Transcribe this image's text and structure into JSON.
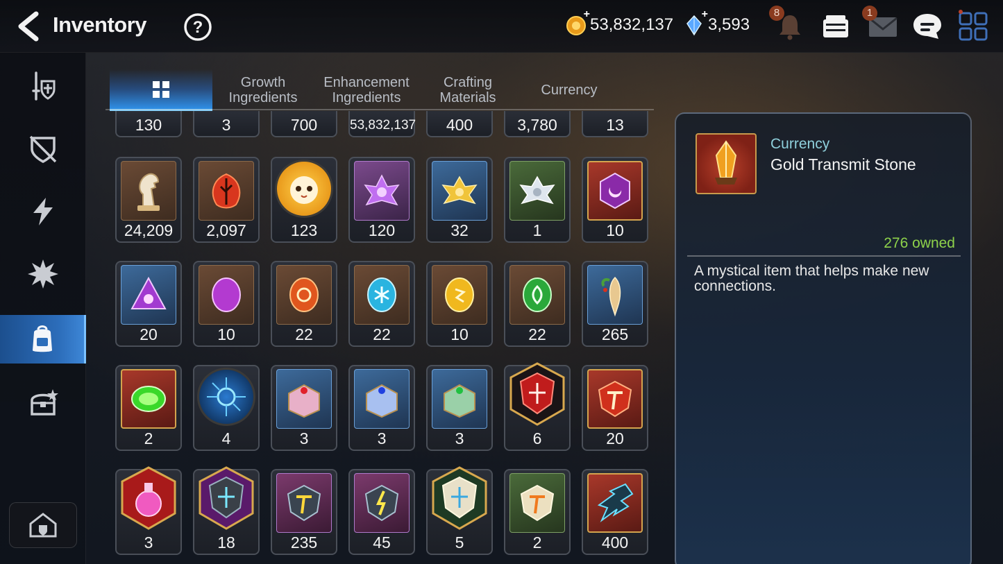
{
  "header": {
    "title": "Inventory",
    "gold": "53,832,137",
    "crystals": "3,593",
    "notifications_badge": "8",
    "mail_badge": "1",
    "plus": "+"
  },
  "sidebar": {
    "items": [
      {
        "name": "equipment",
        "active": false
      },
      {
        "name": "artifacts",
        "active": false
      },
      {
        "name": "exclusive",
        "active": false
      },
      {
        "name": "catalysts",
        "active": false
      },
      {
        "name": "items",
        "active": true
      },
      {
        "name": "chests",
        "active": false
      }
    ]
  },
  "tabs": [
    {
      "label": "",
      "icon": "grid-icon",
      "active": true
    },
    {
      "label": "Growth\nIngredients",
      "active": false
    },
    {
      "label": "Enhancement\nIngredients",
      "active": false
    },
    {
      "label": "Crafting\nMaterials",
      "active": false
    },
    {
      "label": "Currency",
      "active": false
    }
  ],
  "grid": {
    "partial_row": [
      "130",
      "3",
      "700",
      "53,832,137",
      "400",
      "3,780",
      "13"
    ],
    "rows": [
      [
        {
          "count": "24,209",
          "icon": "horse-statue-icon",
          "frame": "brown"
        },
        {
          "count": "2,097",
          "icon": "red-leaf-icon",
          "frame": "brown"
        },
        {
          "count": "123",
          "icon": "pet-face-icon",
          "frame": "round"
        },
        {
          "count": "120",
          "icon": "purple-lotus-icon",
          "frame": "purple"
        },
        {
          "count": "32",
          "icon": "gold-lotus-icon",
          "frame": "blue"
        },
        {
          "count": "1",
          "icon": "silver-lotus-icon",
          "frame": "green"
        },
        {
          "count": "10",
          "icon": "purple-hex-gem-icon",
          "frame": "gold"
        }
      ],
      [
        {
          "count": "20",
          "icon": "purple-triangle-rune-icon",
          "frame": "blue"
        },
        {
          "count": "10",
          "icon": "pink-oval-rune-icon",
          "frame": "brown"
        },
        {
          "count": "22",
          "icon": "orange-oval-rune-icon",
          "frame": "brown"
        },
        {
          "count": "22",
          "icon": "cyan-oval-rune-icon",
          "frame": "brown"
        },
        {
          "count": "10",
          "icon": "yellow-oval-rune-icon",
          "frame": "brown"
        },
        {
          "count": "22",
          "icon": "green-oval-rune-icon",
          "frame": "brown"
        },
        {
          "count": "265",
          "icon": "ginseng-root-icon",
          "frame": "blue"
        }
      ],
      [
        {
          "count": "2",
          "icon": "green-gem-icon",
          "frame": "gold"
        },
        {
          "count": "4",
          "icon": "blue-circuit-orb-icon",
          "frame": "round"
        },
        {
          "count": "3",
          "icon": "pink-chest-icon",
          "frame": "blue"
        },
        {
          "count": "3",
          "icon": "blue-chest-icon",
          "frame": "blue"
        },
        {
          "count": "3",
          "icon": "green-chest-icon",
          "frame": "blue"
        },
        {
          "count": "6",
          "icon": "red-hex-stone-icon",
          "frame": "hex"
        },
        {
          "count": "20",
          "icon": "red-t-stone-icon",
          "frame": "gold"
        }
      ],
      [
        {
          "count": "3",
          "icon": "potion-icon",
          "frame": "hex"
        },
        {
          "count": "18",
          "icon": "cross-stone-icon",
          "frame": "hex"
        },
        {
          "count": "235",
          "icon": "yellow-t-stone-icon",
          "frame": "purple"
        },
        {
          "count": "45",
          "icon": "lightning-stone-icon",
          "frame": "purple"
        },
        {
          "count": "5",
          "icon": "white-cross-stone-icon",
          "frame": "hex"
        },
        {
          "count": "2",
          "icon": "orange-t-stone-icon",
          "frame": "green"
        },
        {
          "count": "400",
          "icon": "crystal-shard-icon",
          "frame": "gold"
        }
      ]
    ]
  },
  "detail": {
    "category": "Currency",
    "name": "Gold Transmit Stone",
    "owned": "276 owned",
    "description": "A mystical item that helps make new connections."
  },
  "colors": {
    "accent": "#2f8fe6",
    "owned_green": "#8ed24b",
    "category_teal": "#8fd0dc"
  }
}
